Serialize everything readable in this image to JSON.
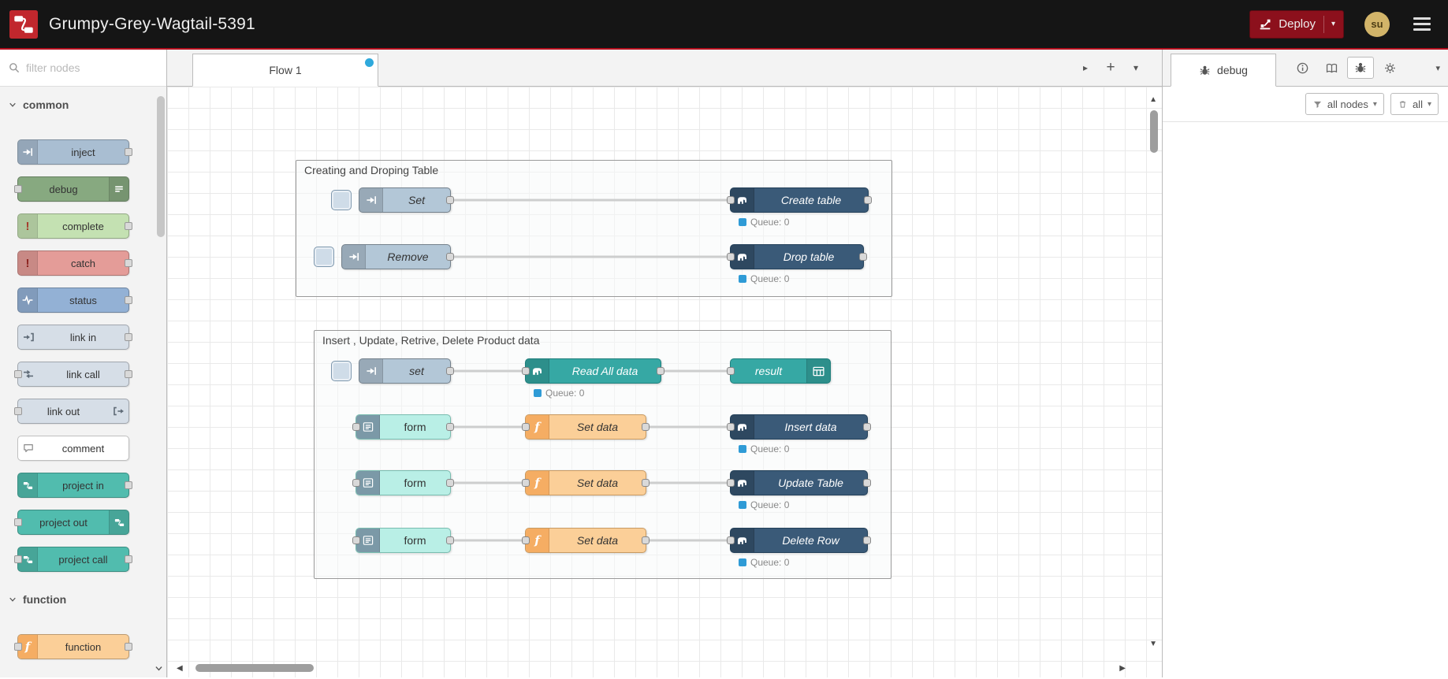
{
  "header": {
    "title": "Grumpy-Grey-Wagtail-5391",
    "deploy": {
      "label": "Deploy"
    },
    "user": {
      "initials": "su"
    }
  },
  "palette": {
    "search_placeholder": "filter nodes",
    "categories": [
      {
        "label": "common",
        "nodes": [
          {
            "label": "inject"
          },
          {
            "label": "debug"
          },
          {
            "label": "complete"
          },
          {
            "label": "catch"
          },
          {
            "label": "status"
          },
          {
            "label": "link in"
          },
          {
            "label": "link call"
          },
          {
            "label": "link out"
          },
          {
            "label": "comment"
          },
          {
            "label": "project in"
          },
          {
            "label": "project out"
          },
          {
            "label": "project call"
          }
        ]
      },
      {
        "label": "function",
        "nodes": [
          {
            "label": "function"
          }
        ]
      }
    ]
  },
  "workspace": {
    "tab": {
      "label": "Flow 1",
      "modified": true
    },
    "groups": [
      {
        "label": "Creating and Droping Table"
      },
      {
        "label": "Insert , Update, Retrive, Delete Product data"
      }
    ],
    "nodes": {
      "set_inject": {
        "label": "Set"
      },
      "create_table": {
        "label": "Create table"
      },
      "remove_inject": {
        "label": "Remove"
      },
      "drop_table": {
        "label": "Drop table"
      },
      "set_inject2": {
        "label": "set"
      },
      "read_all": {
        "label": "Read All data"
      },
      "result": {
        "label": "result"
      },
      "form": {
        "label": "form"
      },
      "set_data": {
        "label": "Set data"
      },
      "insert_data": {
        "label": "Insert data"
      },
      "update_table": {
        "label": "Update Table"
      },
      "delete_row": {
        "label": "Delete Row"
      }
    },
    "status_label": "Queue: 0"
  },
  "sidebar": {
    "tab": {
      "label": "debug"
    },
    "toolbar": {
      "filter_label": "all nodes",
      "clear_label": "all"
    }
  },
  "icons": {
    "plus": "+",
    "caret_down": "▾",
    "chevron_right": "▸",
    "scroll_up": "▲",
    "scroll_down": "▼",
    "scroll_left": "◀",
    "scroll_right": "▶"
  },
  "colors": {
    "header_bg": "#151515",
    "header_accent_line": "#b40f1e",
    "deploy_red": "#8C101C",
    "inject_node": "#a9bed2",
    "debug_node": "#87a980",
    "complete_node": "#c4e1b2",
    "catch_node": "#e49c98",
    "status_node": "#93b1d5",
    "link_node": "#d6dee7",
    "project_node": "#51bcae",
    "function_node": "#fbcf98",
    "postgres_node": "#3a5a78",
    "teal_node": "#36a8a4",
    "form_node": "#b9efe6",
    "status_dot_blue": "#2f9bd6",
    "tab_modified_dot": "#2fa9dc"
  }
}
